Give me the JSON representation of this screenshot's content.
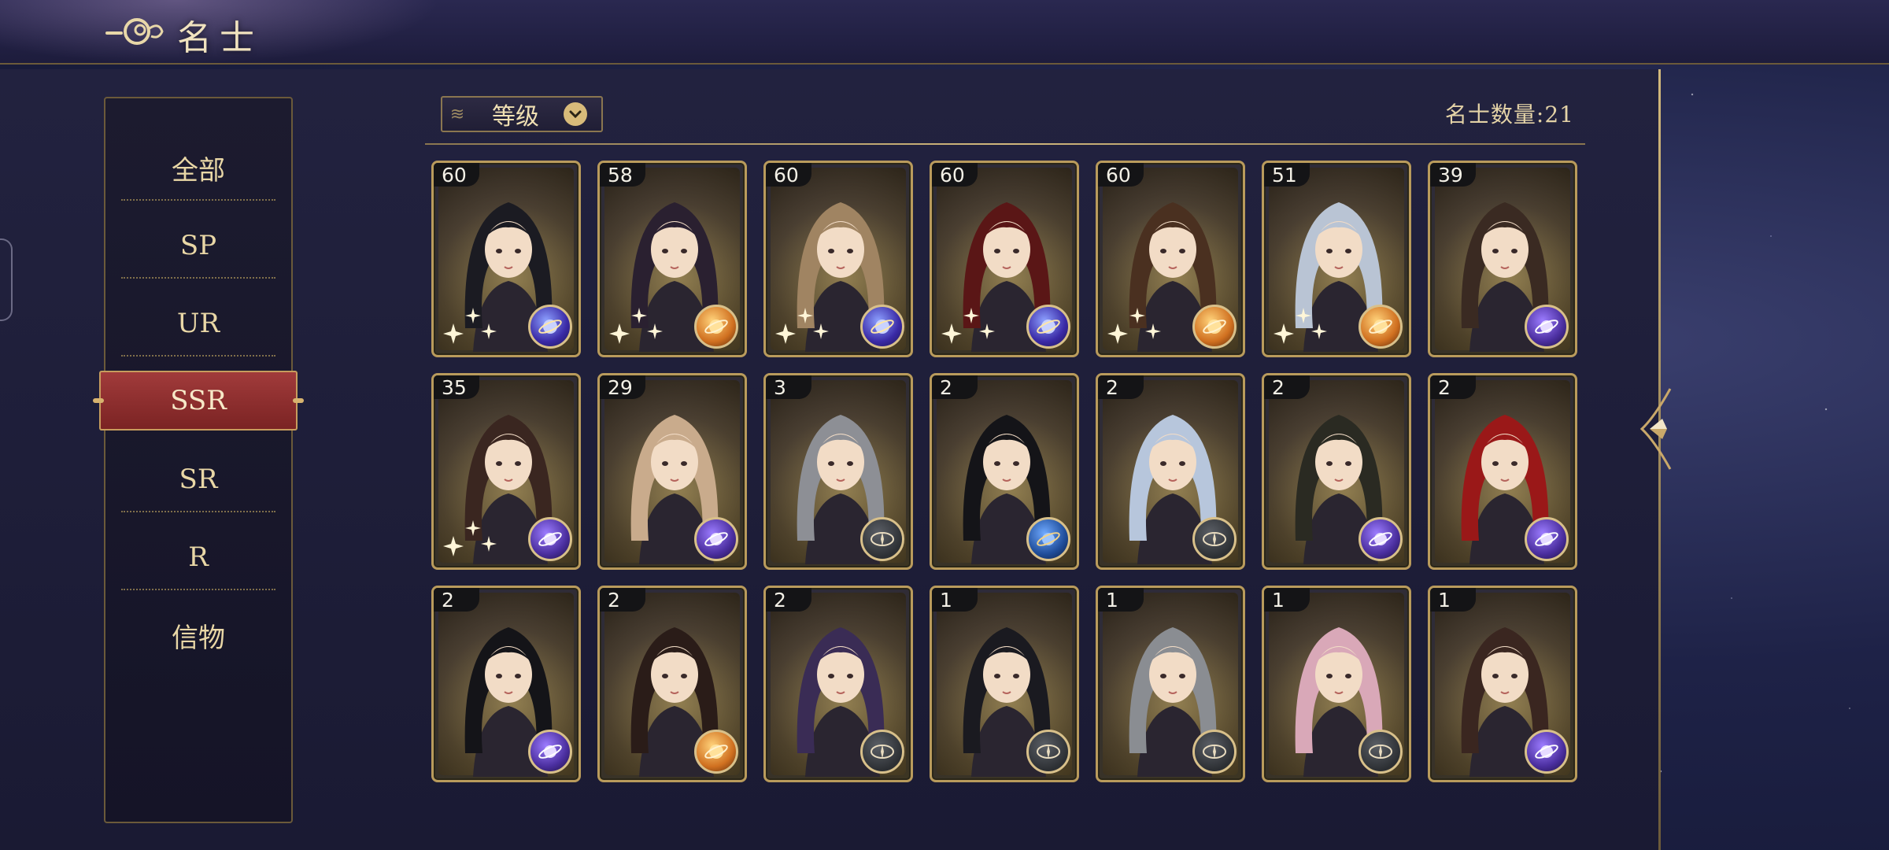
{
  "header": {
    "title": "名士"
  },
  "sidebar": {
    "items": [
      {
        "label": "全部"
      },
      {
        "label": "SP"
      },
      {
        "label": "UR"
      },
      {
        "label": "SSR",
        "active": true
      },
      {
        "label": "SR"
      },
      {
        "label": "R"
      },
      {
        "label": "信物"
      }
    ]
  },
  "sort": {
    "label": "等级",
    "icon": "chevron-down-icon"
  },
  "count": {
    "label": "名士数量:",
    "value": "21"
  },
  "cards": [
    {
      "level": "60",
      "element": "star",
      "hair": "#1b1b22",
      "sparkle": true
    },
    {
      "level": "58",
      "element": "fire",
      "hair": "#2a2030",
      "sparkle": true
    },
    {
      "level": "60",
      "element": "star",
      "hair": "#a08462",
      "sparkle": true
    },
    {
      "level": "60",
      "element": "star",
      "hair": "#5a1616",
      "sparkle": true
    },
    {
      "level": "60",
      "element": "fire",
      "hair": "#4a3020",
      "sparkle": true
    },
    {
      "level": "51",
      "element": "fire",
      "hair": "#b9c4d4",
      "sparkle": true
    },
    {
      "level": "39",
      "element": "saturn",
      "hair": "#3a2a22",
      "sparkle": false
    },
    {
      "level": "35",
      "element": "saturn",
      "hair": "#3a2620",
      "sparkle": true
    },
    {
      "level": "29",
      "element": "saturn",
      "hair": "#c9ab8c",
      "sparkle": false
    },
    {
      "level": "3",
      "element": "compass",
      "hair": "#8d8f95",
      "sparkle": false
    },
    {
      "level": "2",
      "element": "blue",
      "hair": "#141418",
      "sparkle": false
    },
    {
      "level": "2",
      "element": "compass",
      "hair": "#b7c6dc",
      "sparkle": false
    },
    {
      "level": "2",
      "element": "saturn",
      "hair": "#2a2a22",
      "sparkle": false
    },
    {
      "level": "2",
      "element": "saturn",
      "hair": "#9a1818",
      "sparkle": false
    },
    {
      "level": "2",
      "element": "saturn",
      "hair": "#141418",
      "sparkle": false
    },
    {
      "level": "2",
      "element": "fire",
      "hair": "#2a1c18",
      "sparkle": false
    },
    {
      "level": "2",
      "element": "compass",
      "hair": "#3a2c55",
      "sparkle": false
    },
    {
      "level": "1",
      "element": "compass",
      "hair": "#1a1a20",
      "sparkle": false
    },
    {
      "level": "1",
      "element": "compass",
      "hair": "#8a8d92",
      "sparkle": false
    },
    {
      "level": "1",
      "element": "compass",
      "hair": "#d9a8b8",
      "sparkle": false
    },
    {
      "level": "1",
      "element": "saturn",
      "hair": "#3a2620",
      "sparkle": false
    }
  ],
  "colors": {
    "accent": "#a13b3b",
    "gold": "#b99b5c",
    "text": "#e9d7a6"
  }
}
